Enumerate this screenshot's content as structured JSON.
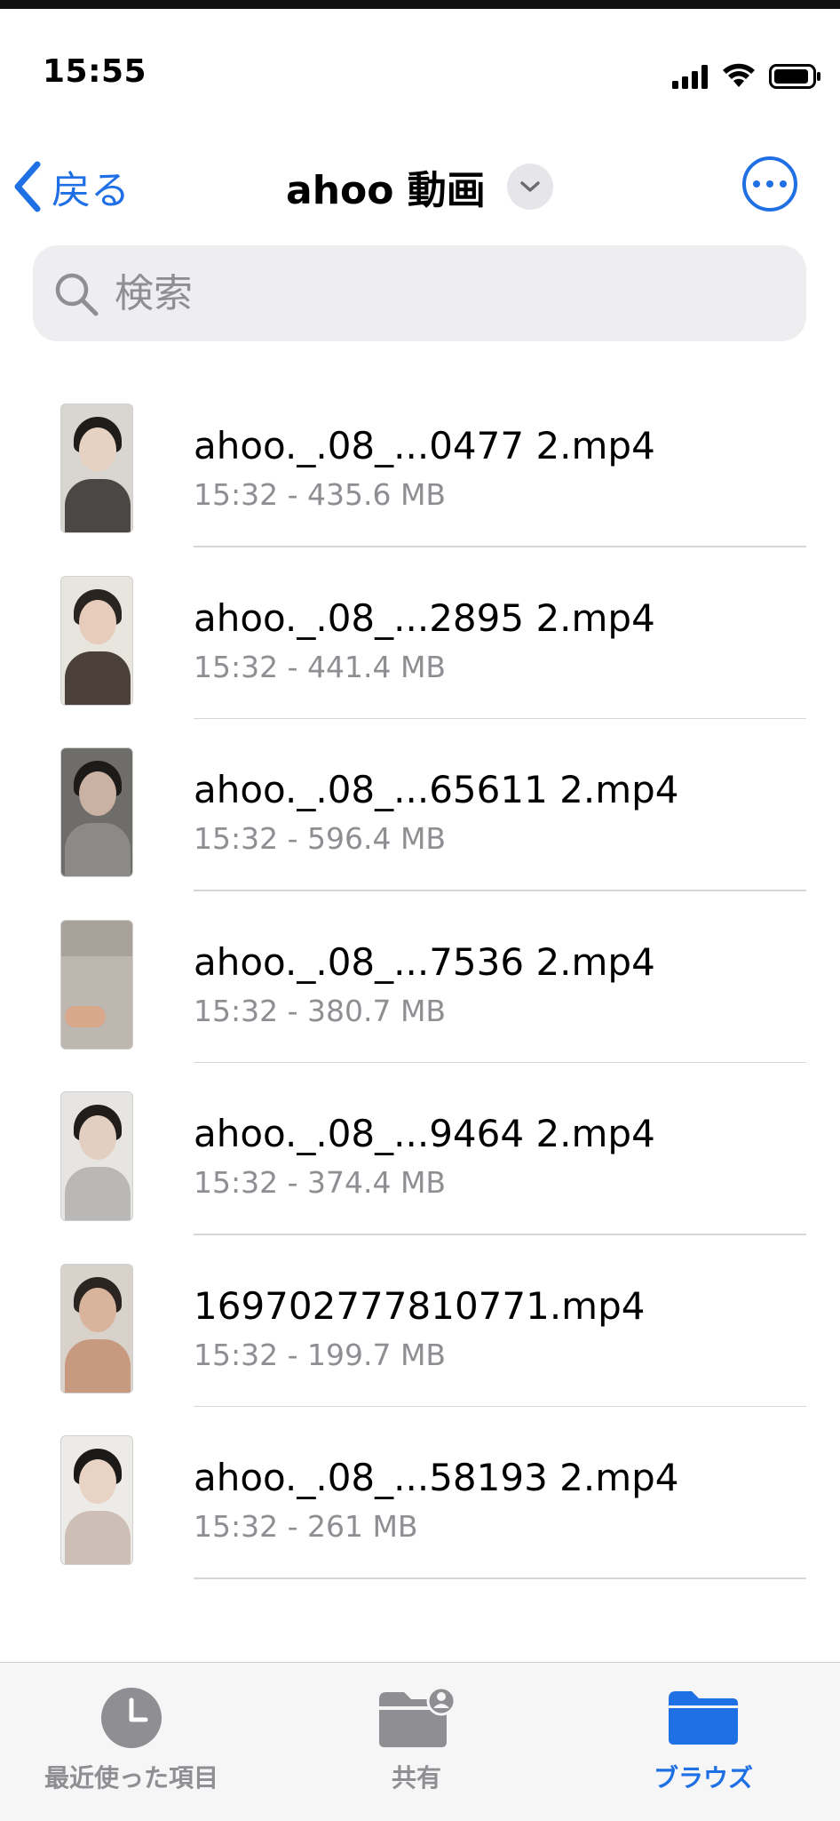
{
  "status_bar": {
    "time": "15:55"
  },
  "nav": {
    "back_label": "戻る",
    "title": "ahoo 動画"
  },
  "search": {
    "placeholder": "検索"
  },
  "files": [
    {
      "name": "ahoo._.08_...0477 2.mp4",
      "meta": "15:32 - 435.6 MB"
    },
    {
      "name": "ahoo._.08_...2895 2.mp4",
      "meta": "15:32 - 441.4 MB"
    },
    {
      "name": "ahoo._.08_...65611 2.mp4",
      "meta": "15:32 - 596.4 MB"
    },
    {
      "name": "ahoo._.08_...7536 2.mp4",
      "meta": "15:32 - 380.7 MB"
    },
    {
      "name": "ahoo._.08_...9464 2.mp4",
      "meta": "15:32 - 374.4 MB"
    },
    {
      "name": "169702777810771.mp4",
      "meta": "15:32 - 199.7 MB"
    },
    {
      "name": "ahoo._.08_...58193 2.mp4",
      "meta": "15:32 - 261 MB"
    }
  ],
  "tabs": [
    {
      "label": "最近使った項目",
      "icon": "clock-icon"
    },
    {
      "label": "共有",
      "icon": "shared-folder-icon"
    },
    {
      "label": "ブラウズ",
      "icon": "folder-icon"
    }
  ],
  "colors": {
    "accent": "#1f6fe5",
    "secondary_text": "#8e8e93"
  }
}
